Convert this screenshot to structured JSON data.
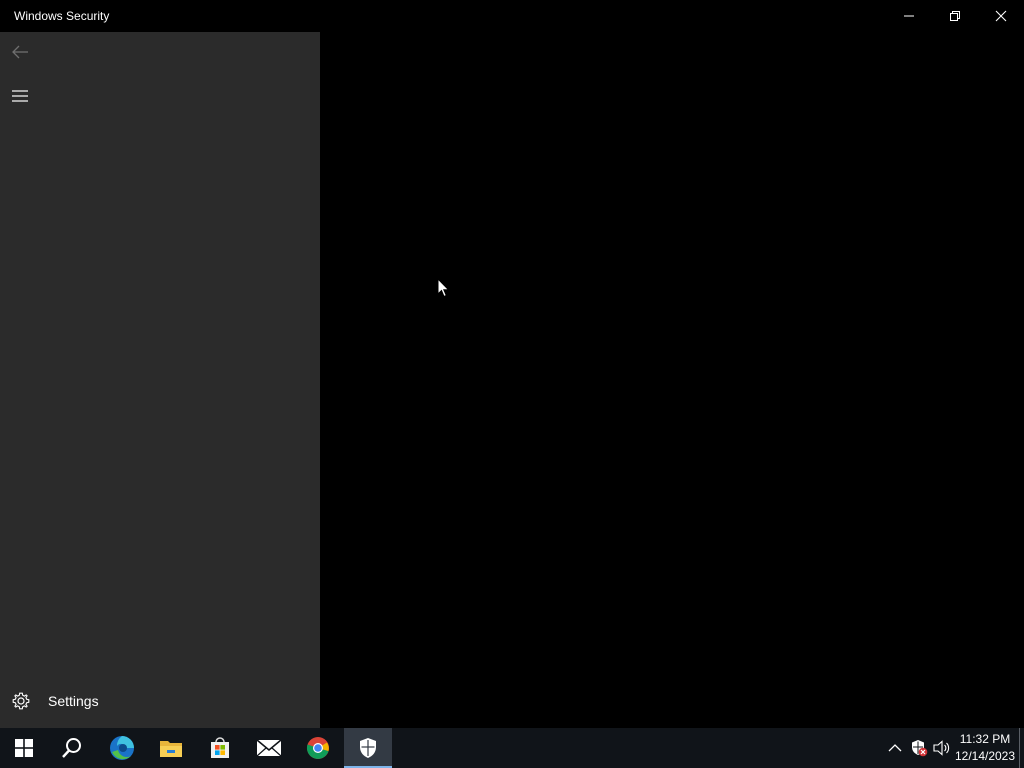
{
  "window": {
    "title": "Windows Security",
    "controls": {
      "minimize": "minimize-icon",
      "restore": "restore-icon",
      "close": "close-icon"
    }
  },
  "sidebar": {
    "back_icon": "back-arrow-icon",
    "menu_icon": "hamburger-menu-icon",
    "settings": {
      "icon": "gear-icon",
      "label": "Settings"
    }
  },
  "taskbar": {
    "apps": [
      {
        "name": "Start",
        "icon": "windows-logo-icon"
      },
      {
        "name": "Search",
        "icon": "search-icon"
      },
      {
        "name": "Microsoft Edge",
        "icon": "edge-icon"
      },
      {
        "name": "File Explorer",
        "icon": "folder-icon"
      },
      {
        "name": "Microsoft Store",
        "icon": "store-icon"
      },
      {
        "name": "Mail",
        "icon": "mail-icon"
      },
      {
        "name": "Google Chrome",
        "icon": "chrome-icon"
      },
      {
        "name": "Windows Security",
        "icon": "shield-icon",
        "active": true
      }
    ],
    "tray": {
      "icons": [
        "chevron-up-icon",
        "security-alert-icon",
        "volume-icon"
      ],
      "time": "11:32 PM",
      "date": "12/14/2023"
    }
  },
  "colors": {
    "sidebar_bg": "#2b2b2b",
    "content_bg": "#000000",
    "taskbar_bg": "#101419",
    "accent": "#7eb4ea"
  }
}
